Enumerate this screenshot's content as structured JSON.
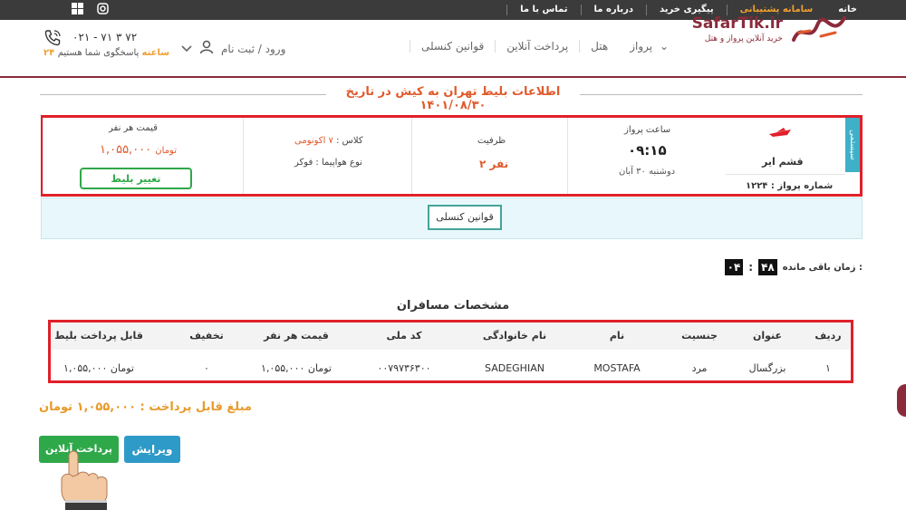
{
  "topbar": {
    "nav": [
      "خانه",
      "سامانه پشتیبانی",
      "پیگیری خرید",
      "درباره ما",
      "تماس با ما"
    ],
    "active_index": 1,
    "social": [
      "instagram-icon",
      "windows-icon"
    ]
  },
  "header": {
    "logo_text": "SafarTik.ir",
    "logo_sub": "خرید آنلاین پرواز و هتل",
    "nav": [
      "پرواز",
      "هتل",
      "پرداخت آنلاین",
      "قوانین کنسلی"
    ],
    "login": "ورود / ثبت نام",
    "phone": "۰۲۱ - ۷۱ ۳ ۷۲",
    "support_hours": "۲۴ ساعته",
    "support_text": "پاسخگوی شما هستیم"
  },
  "page": {
    "section_title": "اطلاعات بلیط تهران به کیش در تاریخ ۱۴۰۱/۰۸/۳۰"
  },
  "flight": {
    "system_tag": "سیستمی",
    "airline": "قشم ایر",
    "flight_number_label": "شماره پرواز :",
    "flight_number": "۱۲۲۴",
    "time_label": "ساعت پرواز",
    "time": "۰۹:۱۵",
    "date": "دوشنبه ۳۰ آبان",
    "capacity_label": "ظرفیت",
    "capacity": "۲ نفر",
    "class_label": "کلاس :",
    "class_value": "۷ اکونومی",
    "aircraft_label": "نوع هواپیما :",
    "aircraft": "فوکر",
    "price_label": "قیمت هر نفر",
    "price": "۱,۰۵۵,۰۰۰",
    "currency": "تومان",
    "change_button": "تغییر بلیط"
  },
  "rules": {
    "button": "قوانین کنسلی"
  },
  "timer": {
    "label": "زمان باقی مانده",
    "minutes": "۴۸",
    "seconds": "۰۴"
  },
  "passengers": {
    "title": "مشخصات مسافران",
    "headers": [
      "ردیف",
      "عنوان",
      "جنسیت",
      "نام",
      "نام خانوادگی",
      "کد ملی",
      "قیمت هر نفر",
      "تخفیف",
      "قابل پرداخت بلیط"
    ],
    "rows": [
      [
        "۱",
        "بزرگسال",
        "مرد",
        "MOSTAFA",
        "SADEGHIAN",
        "۰۰۷۹۷۳۶۳۰۰",
        "۱,۰۵۵,۰۰۰ تومان",
        "۰",
        "۱,۰۵۵,۰۰۰ تومان"
      ]
    ]
  },
  "payment": {
    "total_text": "مبلغ قابل پرداخت : ۱,۰۵۵,۰۰۰ تومان",
    "pay_button": "پرداخت آنلاین",
    "edit_button": "ویرایش"
  },
  "colors": {
    "accent": "#8a2b3b",
    "highlight": "#e0202a",
    "orange": "#e05a2b",
    "green": "#2fa84a",
    "blue": "#2e9ac8"
  }
}
